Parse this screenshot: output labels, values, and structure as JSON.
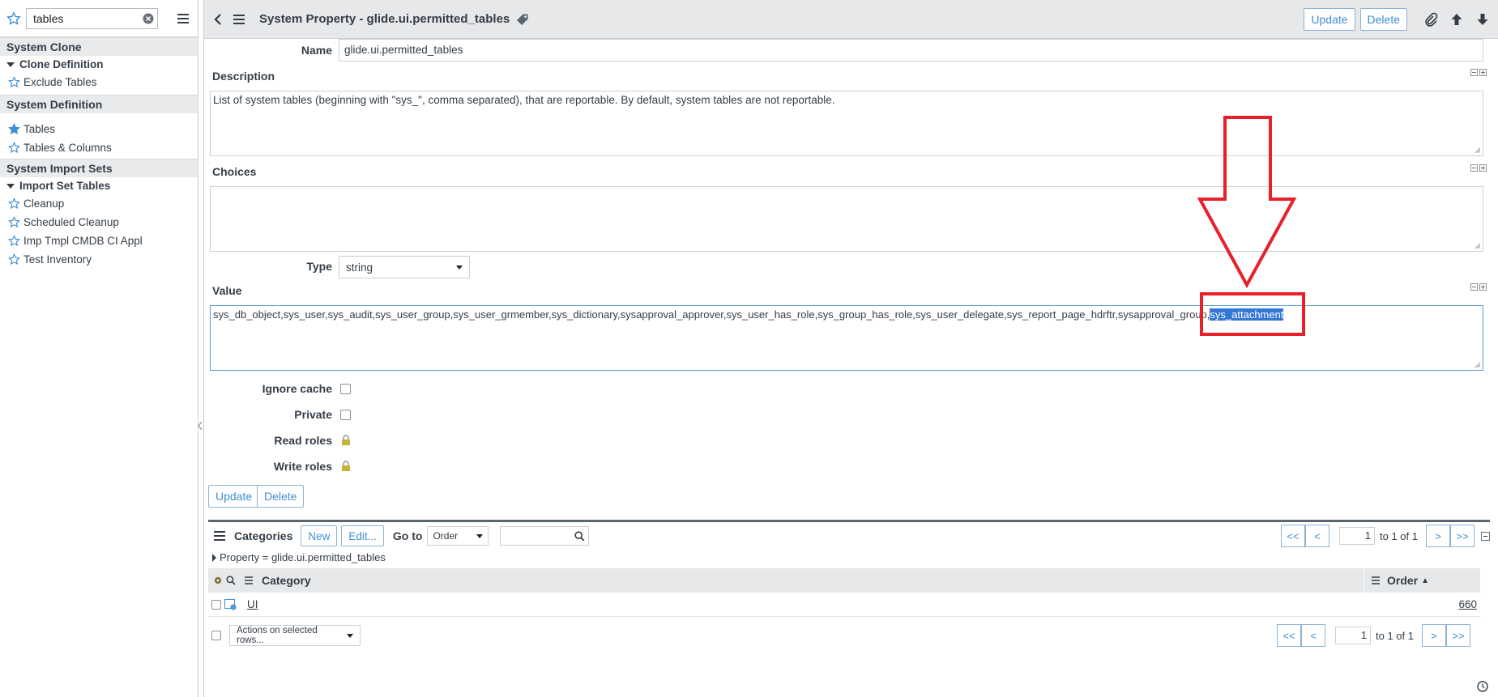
{
  "sidebar": {
    "filter_value": "tables",
    "sections": [
      {
        "title": "System Clone",
        "groups": [
          {
            "title": "Clone Definition",
            "items": [
              {
                "label": "Exclude Tables",
                "favorite": false
              }
            ]
          }
        ]
      },
      {
        "title": "System Definition",
        "items": [
          {
            "label": "Tables",
            "favorite": true
          },
          {
            "label": "Tables & Columns",
            "favorite": false
          }
        ]
      },
      {
        "title": "System Import Sets",
        "groups": [
          {
            "title": "Import Set Tables",
            "items": [
              {
                "label": "Cleanup",
                "favorite": false
              },
              {
                "label": "Scheduled Cleanup",
                "favorite": false
              },
              {
                "label": "Imp Tmpl CMDB CI Appl",
                "favorite": false
              },
              {
                "label": "Test Inventory",
                "favorite": false
              }
            ]
          }
        ]
      }
    ]
  },
  "header": {
    "title": "System Property - glide.ui.permitted_tables",
    "update_label": "Update",
    "delete_label": "Delete"
  },
  "form": {
    "name_label": "Name",
    "name_value": "glide.ui.permitted_tables",
    "description_label": "Description",
    "description_value": "List of system tables (beginning with \"sys_\", comma separated), that are reportable. By default, system tables are not reportable.",
    "choices_label": "Choices",
    "choices_value": "",
    "type_label": "Type",
    "type_value": "string",
    "value_label": "Value",
    "value_text": "sys_db_object,sys_user,sys_audit,sys_user_group,sys_user_grmember,sys_dictionary,sysapproval_approver,sys_user_has_role,sys_group_has_role,sys_user_delegate,sys_report_page_hdrftr,sysapproval_group,",
    "value_selected": "sys_attachment",
    "ignore_cache_label": "Ignore cache",
    "private_label": "Private",
    "read_roles_label": "Read roles",
    "write_roles_label": "Write roles",
    "update_label": "Update",
    "delete_label": "Delete"
  },
  "related_list": {
    "title": "Categories",
    "new_label": "New",
    "edit_label": "Edit...",
    "goto_label": "Go to",
    "goto_select": "Order",
    "first_label": "<<",
    "prev_label": "<",
    "next_label": ">",
    "last_label": ">>",
    "page_value": "1",
    "page_text": "to 1 of 1",
    "filter_text": "Property = glide.ui.permitted_tables",
    "columns": [
      "Category",
      "Order"
    ],
    "rows": [
      {
        "category": "UI",
        "order": "660"
      }
    ],
    "actions_label": "Actions on selected rows..."
  },
  "colors": {
    "accent": "#3f8ed3",
    "selection": "#3476d6",
    "annotation": "#e8202a"
  }
}
